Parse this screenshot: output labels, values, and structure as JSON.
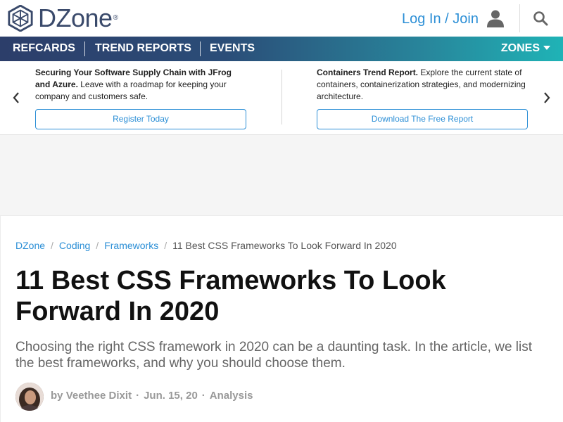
{
  "header": {
    "logo_text": "DZone",
    "logo_reg": "®",
    "login_label": "Log In / Join"
  },
  "nav": {
    "items": [
      "REFCARDS",
      "TREND REPORTS",
      "EVENTS"
    ],
    "zones_label": "ZONES"
  },
  "promo": {
    "left": {
      "bold": "Securing Your Software Supply Chain with JFrog and Azure.",
      "text": " Leave with a roadmap for keeping your company and customers safe.",
      "button": "Register Today"
    },
    "right": {
      "bold": "Containers Trend Report.",
      "text": " Explore the current state of containers, containerization strategies, and modernizing architecture.",
      "button": "Download The Free Report"
    }
  },
  "breadcrumb": {
    "items": [
      "DZone",
      "Coding",
      "Frameworks"
    ],
    "current": "11 Best CSS Frameworks To Look Forward In 2020",
    "separator": "/"
  },
  "article": {
    "title": "11 Best CSS Frameworks To Look Forward In 2020",
    "subtitle": "Choosing the right CSS framework in 2020 can be a daunting task. In the article, we list the best frameworks, and why you should choose them.",
    "byline_prefix": "by",
    "author": "Veethee Dixit",
    "date": "Jun. 15, 20",
    "category": "Analysis",
    "dot": "·"
  },
  "colors": {
    "brand_dark": "#3a4a6b",
    "link": "#2c8fd6",
    "nav_start": "#2c3e6a",
    "nav_end": "#1fb3b6"
  },
  "icons": [
    "dzone-logo-icon",
    "user-icon",
    "search-icon",
    "chevron-left-icon",
    "chevron-right-icon",
    "caret-down-icon"
  ]
}
